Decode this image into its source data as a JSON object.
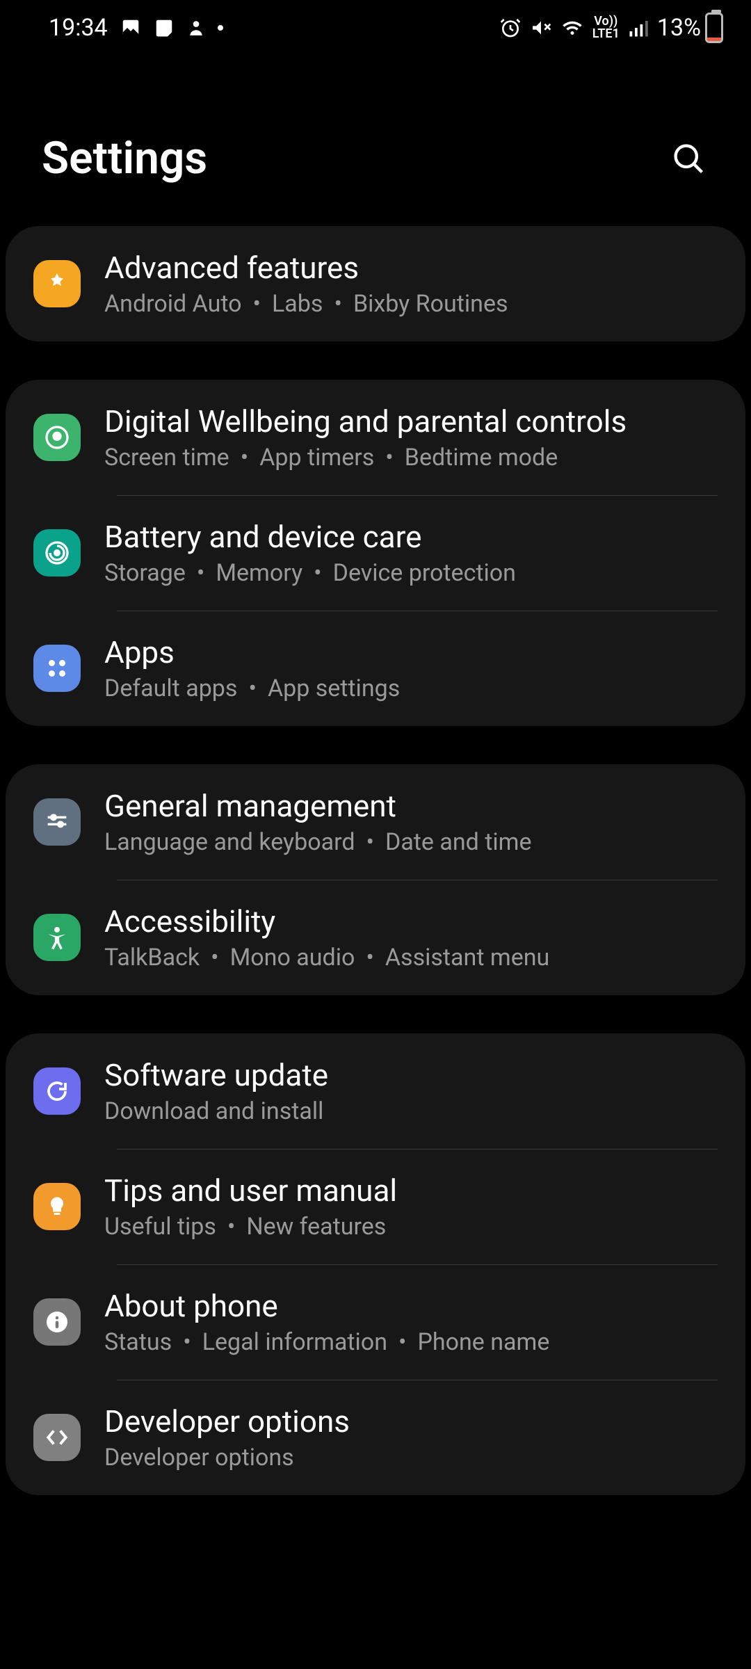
{
  "status_bar": {
    "time": "19:34",
    "battery_pct": "13%"
  },
  "header": {
    "title": "Settings"
  },
  "groups": [
    {
      "items": [
        {
          "icon": "advanced-icon",
          "title": "Advanced features",
          "subs": [
            "Android Auto",
            "Labs",
            "Bixby Routines"
          ]
        }
      ]
    },
    {
      "items": [
        {
          "icon": "wellbeing-icon",
          "title": "Digital Wellbeing and parental controls",
          "subs": [
            "Screen time",
            "App timers",
            "Bedtime mode"
          ]
        },
        {
          "icon": "battery-care-icon",
          "title": "Battery and device care",
          "subs": [
            "Storage",
            "Memory",
            "Device protection"
          ]
        },
        {
          "icon": "apps-icon",
          "title": "Apps",
          "subs": [
            "Default apps",
            "App settings"
          ]
        }
      ]
    },
    {
      "items": [
        {
          "icon": "general-icon",
          "title": "General management",
          "subs": [
            "Language and keyboard",
            "Date and time"
          ]
        },
        {
          "icon": "accessibility-icon",
          "title": "Accessibility",
          "subs": [
            "TalkBack",
            "Mono audio",
            "Assistant menu"
          ]
        }
      ]
    },
    {
      "items": [
        {
          "icon": "update-icon",
          "title": "Software update",
          "subs": [
            "Download and install"
          ]
        },
        {
          "icon": "tips-icon",
          "title": "Tips and user manual",
          "subs": [
            "Useful tips",
            "New features"
          ]
        },
        {
          "icon": "about-icon",
          "title": "About phone",
          "subs": [
            "Status",
            "Legal information",
            "Phone name"
          ]
        },
        {
          "icon": "developer-icon",
          "title": "Developer options",
          "subs": [
            "Developer options"
          ]
        }
      ]
    }
  ]
}
